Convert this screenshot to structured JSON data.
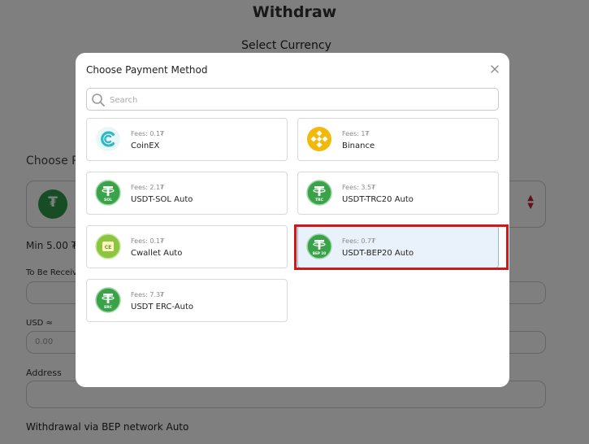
{
  "background": {
    "page_title": "Withdraw",
    "select_currency": "Select Currency",
    "choose_label": "Choose Pa",
    "selected_coin_symbol": "₮",
    "min_text": "Min 5.00 ₮",
    "receive_label": "To Be Receive",
    "usd_label": "USD ≈",
    "usd_value": "0.00",
    "address_label": "Address",
    "network_note": "Withdrawal via BEP network Auto"
  },
  "modal": {
    "title": "Choose Payment Method",
    "search_placeholder": "Search",
    "methods": [
      {
        "fees": "Fees: 0.1₮",
        "name": "CoinEX",
        "icon": "coinex-icon",
        "color": "#2fb8c8"
      },
      {
        "fees": "Fees: 1₮",
        "name": "Binance",
        "icon": "binance-icon",
        "color": "#f0b90b"
      },
      {
        "fees": "Fees: 2.1₮",
        "name": "USDT-SOL Auto",
        "icon": "usdt-sol-icon",
        "color": "#3aa34a",
        "sublabel": "SOL"
      },
      {
        "fees": "Fees: 3.5₮",
        "name": "USDT-TRC20 Auto",
        "icon": "usdt-trc20-icon",
        "color": "#3aa34a",
        "sublabel": "TRC"
      },
      {
        "fees": "Fees: 0.1₮",
        "name": "Cwallet Auto",
        "icon": "cwallet-icon",
        "color": "#8cc63f",
        "sublabel": "CE"
      },
      {
        "fees": "Fees: 0.7₮",
        "name": "USDT-BEP20 Auto",
        "icon": "usdt-bep20-icon",
        "color": "#3aa34a",
        "sublabel": "BEP 20"
      },
      {
        "fees": "Fees: 7.3₮",
        "name": "USDT ERC-Auto",
        "icon": "usdt-erc-icon",
        "color": "#3aa34a",
        "sublabel": "ERC"
      }
    ],
    "selected_index": 5
  },
  "colors": {
    "overlay": "rgba(0,0,0,0.5)",
    "selected_card_bg": "#e9f2fb",
    "highlight_border": "#d01818"
  }
}
